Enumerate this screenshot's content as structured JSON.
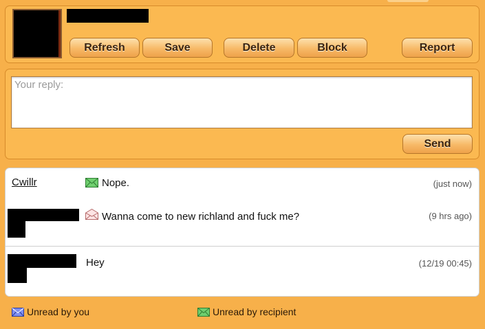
{
  "header": {
    "buttons": {
      "refresh": "Refresh",
      "save": "Save",
      "delete": "Delete",
      "block": "Block",
      "report": "Report"
    }
  },
  "reply": {
    "placeholder": "Your reply:",
    "send_label": "Send"
  },
  "messages": [
    {
      "sender": "Cwillr",
      "icon": "envelope-green-icon",
      "text": "Nope.",
      "time": "(just now)"
    },
    {
      "sender": "",
      "icon": "envelope-open-icon",
      "text": "Wanna come to new richland and fuck me?",
      "time": "(9 hrs ago)"
    },
    {
      "sender": "",
      "icon": "",
      "text": "Hey",
      "time": "(12/19 00:45)"
    }
  ],
  "legend": {
    "unread_by_you": "Unread by you",
    "unread_by_recipient": "Unread by recipient"
  },
  "colors": {
    "background": "#f7b04a",
    "panel": "#fbb951",
    "envelope_blue": "#5a6fd6",
    "envelope_green": "#4caf50"
  }
}
